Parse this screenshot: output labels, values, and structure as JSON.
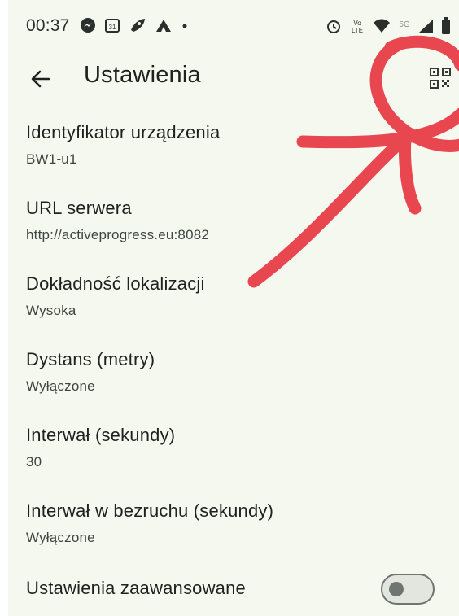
{
  "status_bar": {
    "time": "00:37",
    "left_icons": [
      "messenger-icon",
      "calendar-icon",
      "rocket-icon",
      "app-icon",
      "dot-icon"
    ],
    "calendar_day": "31",
    "right_icons": [
      "alarm-icon",
      "volte-icon",
      "wifi-icon",
      "5g-icon",
      "signal-icon",
      "battery-icon"
    ],
    "volte_text": "Vo LTE",
    "network_text": "5G"
  },
  "app_bar": {
    "title": "Ustawienia"
  },
  "settings": [
    {
      "label": "Identyfikator urządzenia",
      "value": "BW1-u1"
    },
    {
      "label": "URL serwera",
      "value": "http://activeprogress.eu:8082"
    },
    {
      "label": "Dokładność lokalizacji",
      "value": "Wysoka"
    },
    {
      "label": "Dystans (metry)",
      "value": "Wyłączone"
    },
    {
      "label": "Interwał (sekundy)",
      "value": "30"
    },
    {
      "label": "Interwał w bezruchu (sekundy)",
      "value": "Wyłączone"
    }
  ],
  "advanced": {
    "label": "Ustawienia zaawansowane",
    "toggle_on": false
  },
  "colors": {
    "background": "#f4f8ef",
    "annotation": "#e8474f"
  }
}
